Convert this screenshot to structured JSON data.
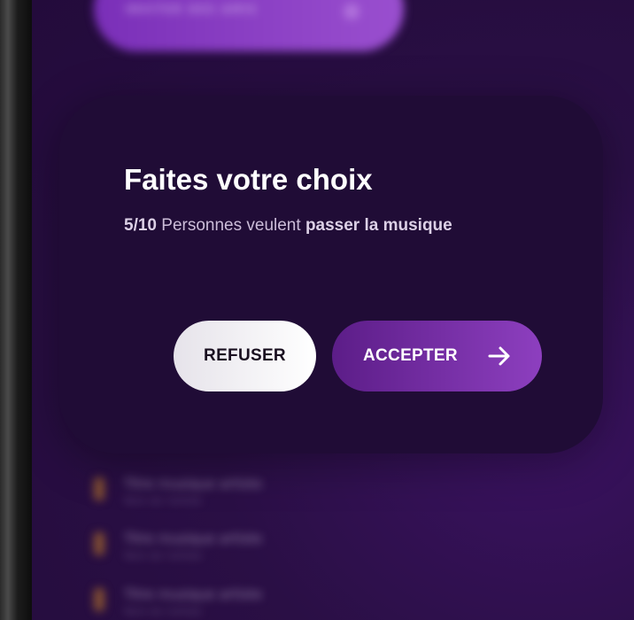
{
  "background": {
    "top_button_label": "INVITER DES AMIS",
    "rows": [
      {
        "title": "Titre musique artiste",
        "subtitle": "Nom de l'artiste"
      },
      {
        "title": "Titre musique artiste",
        "subtitle": "Nom de l'artiste"
      },
      {
        "title": "Titre musique artiste",
        "subtitle": "Nom de l'artiste"
      }
    ]
  },
  "dialog": {
    "title": "Faites votre choix",
    "vote_count": "5/10",
    "vote_text": "Personnes veulent",
    "vote_action": "passer la musique",
    "refuse_label": "REFUSER",
    "accept_label": "ACCEPTER",
    "accept_icon": "arrow-right-icon"
  },
  "colors": {
    "accent": "#8d3fbf",
    "dialog_bg": "#200c36",
    "page_bg": "#2a0f45"
  }
}
